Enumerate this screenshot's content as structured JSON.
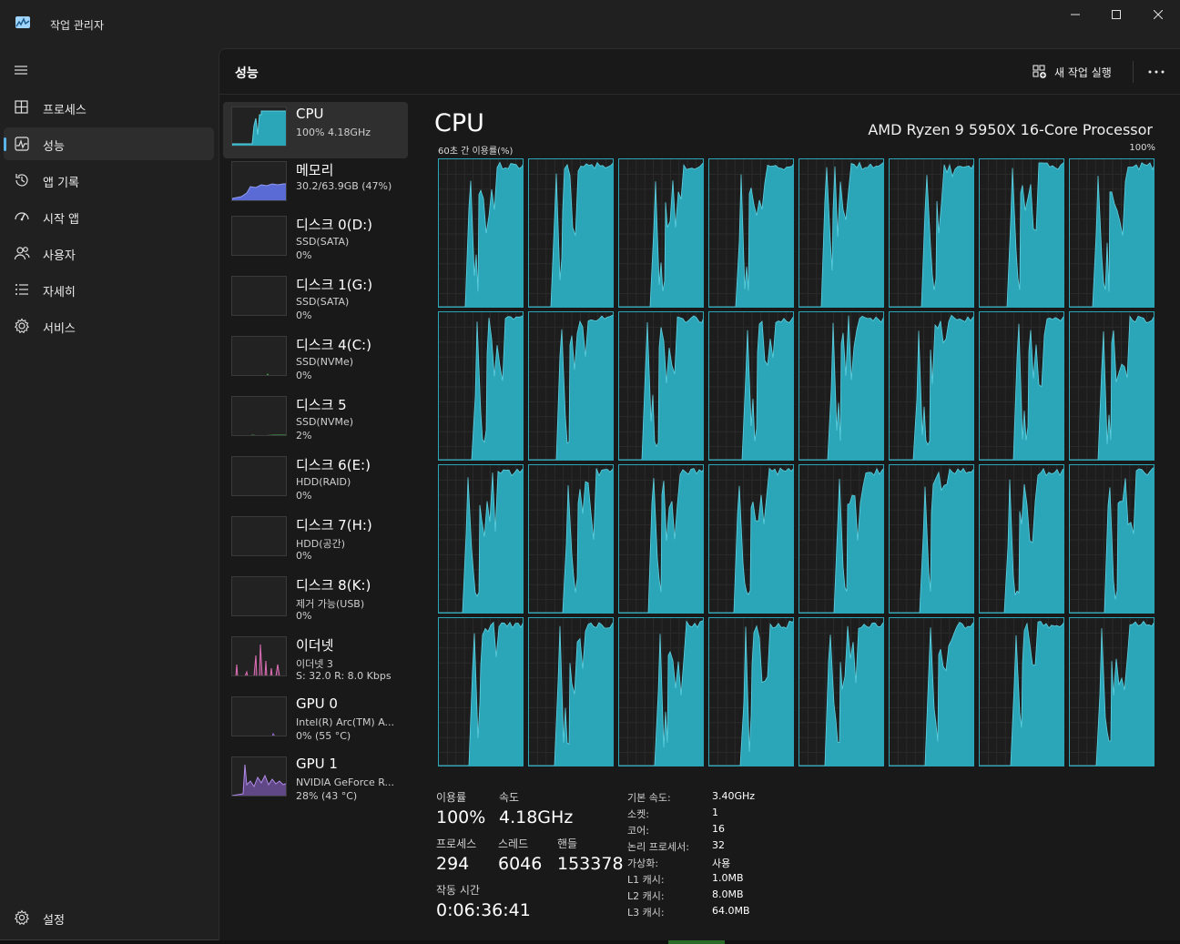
{
  "window": {
    "title": "작업 관리자"
  },
  "nav": {
    "items": [
      {
        "label": "프로세스",
        "icon": "processes-icon"
      },
      {
        "label": "성능",
        "icon": "performance-icon",
        "active": true
      },
      {
        "label": "앱 기록",
        "icon": "app-history-icon"
      },
      {
        "label": "시작 앱",
        "icon": "startup-apps-icon"
      },
      {
        "label": "사용자",
        "icon": "users-icon"
      },
      {
        "label": "자세히",
        "icon": "details-icon"
      },
      {
        "label": "서비스",
        "icon": "services-icon"
      }
    ],
    "settings_label": "설정"
  },
  "header": {
    "title": "성능",
    "run_task_label": "새 작업 실행"
  },
  "resources": [
    {
      "name": "CPU",
      "lines": [
        "100%  4.18GHz"
      ]
    },
    {
      "name": "메모리",
      "lines": [
        "30.2/63.9GB (47%)"
      ]
    },
    {
      "name": "디스크 0(D:)",
      "lines": [
        "SSD(SATA)",
        "0%"
      ]
    },
    {
      "name": "디스크 1(G:)",
      "lines": [
        "SSD(SATA)",
        "0%"
      ]
    },
    {
      "name": "디스크 4(C:)",
      "lines": [
        "SSD(NVMe)",
        "0%"
      ]
    },
    {
      "name": "디스크 5",
      "lines": [
        "SSD(NVMe)",
        "2%"
      ]
    },
    {
      "name": "디스크 6(E:)",
      "lines": [
        "HDD(RAID)",
        "0%"
      ]
    },
    {
      "name": "디스크 7(H:)",
      "lines": [
        "HDD(공간)",
        "0%"
      ]
    },
    {
      "name": "디스크 8(K:)",
      "lines": [
        "제거 가능(USB)",
        "0%"
      ]
    },
    {
      "name": "이더넷",
      "lines": [
        "이더넷 3",
        "S: 32.0  R: 8.0 Kbps"
      ]
    },
    {
      "name": "GPU 0",
      "lines": [
        "Intel(R) Arc(TM) A...",
        "0%  (55 °C)"
      ]
    },
    {
      "name": "GPU 1",
      "lines": [
        "NVIDIA GeForce R...",
        "28%  (43 °C)"
      ]
    }
  ],
  "cpu": {
    "title": "CPU",
    "model": "AMD Ryzen 9 5950X 16-Core Processor",
    "graph_label": "60초 간 이용률(%)",
    "graph_max": "100%",
    "logical_processor_count": 32,
    "graph_color": "#2aa6b8",
    "stats": {
      "utilization_label": "이용률",
      "utilization": "100%",
      "speed_label": "속도",
      "speed": "4.18GHz",
      "processes_label": "프로세스",
      "processes": "294",
      "threads_label": "스레드",
      "threads": "6046",
      "handles_label": "핸들",
      "handles": "153378",
      "uptime_label": "작동 시간",
      "uptime": "0:06:36:41"
    },
    "specs": [
      {
        "key": "기본 속도:",
        "value": "3.40GHz"
      },
      {
        "key": "소켓:",
        "value": "1"
      },
      {
        "key": "코어:",
        "value": "16"
      },
      {
        "key": "논리 프로세서:",
        "value": "32"
      },
      {
        "key": "가상화:",
        "value": "사용"
      },
      {
        "key": "L1 캐시:",
        "value": "1.0MB"
      },
      {
        "key": "L2 캐시:",
        "value": "8.0MB"
      },
      {
        "key": "L3 캐시:",
        "value": "64.0MB"
      }
    ]
  }
}
